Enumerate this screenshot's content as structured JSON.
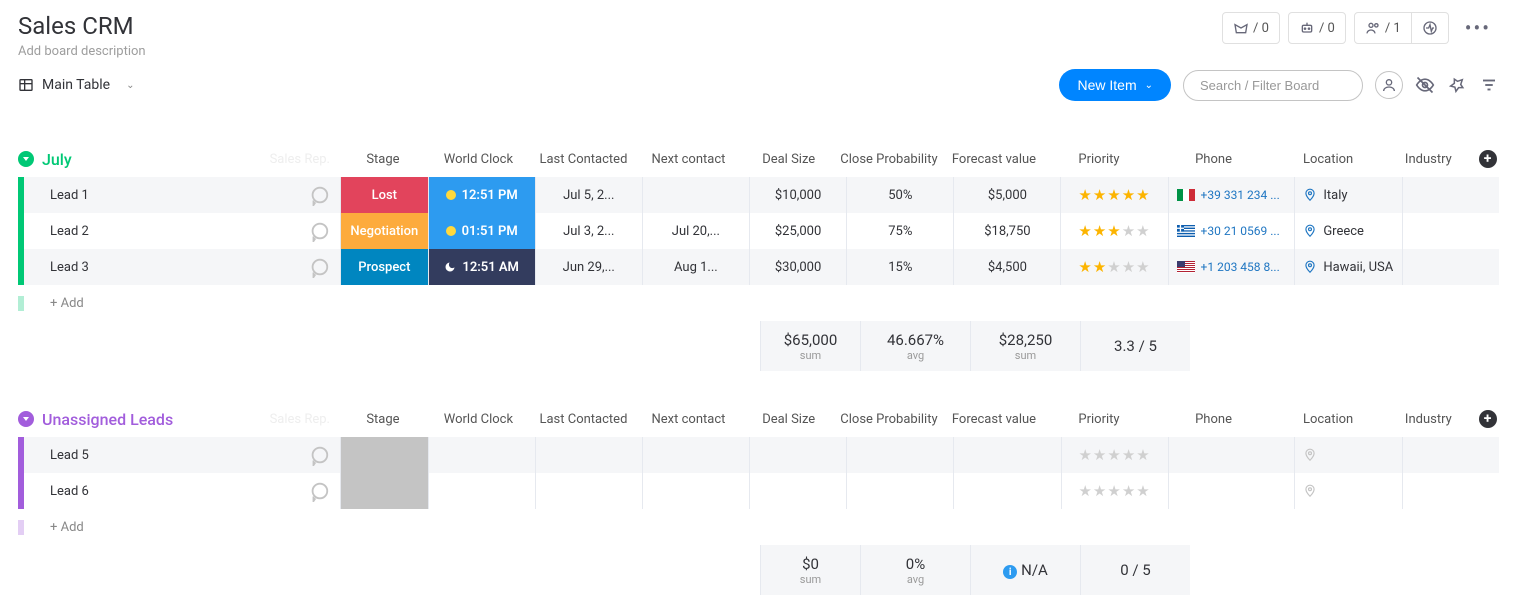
{
  "header": {
    "title": "Sales CRM",
    "description_placeholder": "Add board description",
    "mail_counter": "/ 0",
    "share_counter": "/ 0",
    "members_counter": "/ 1"
  },
  "toolbar": {
    "view_name": "Main Table",
    "new_item_label": "New Item",
    "search_placeholder": "Search / Filter Board"
  },
  "columns": {
    "sales_rep": "Sales Rep.",
    "stage": "Stage",
    "clock": "World Clock",
    "last_contacted": "Last Contacted",
    "next_contact": "Next contact",
    "deal_size": "Deal Size",
    "close_prob": "Close Probability",
    "forecast": "Forecast value",
    "priority": "Priority",
    "phone": "Phone",
    "location": "Location",
    "industry": "Industry"
  },
  "groups": [
    {
      "name": "July",
      "color": "#00c875",
      "rows": [
        {
          "name": "Lead 1",
          "stage": {
            "label": "Lost",
            "class": "stage-lost"
          },
          "clock": {
            "time": "12:51 PM",
            "daynight": "day",
            "class": "clock-blue"
          },
          "last_contacted": "Jul 5, 2...",
          "next_contact": "",
          "deal_size": "$10,000",
          "close_prob": "50%",
          "forecast": "$5,000",
          "priority": 5,
          "phone": {
            "flag": "it",
            "text": "+39 331 234 ..."
          },
          "location": "Italy"
        },
        {
          "name": "Lead 2",
          "stage": {
            "label": "Negotiation",
            "class": "stage-neg"
          },
          "clock": {
            "time": "01:51 PM",
            "daynight": "day",
            "class": "clock-blue"
          },
          "last_contacted": "Jul 3, 2...",
          "next_contact": "Jul 20,...",
          "deal_size": "$25,000",
          "close_prob": "75%",
          "forecast": "$18,750",
          "priority": 3,
          "phone": {
            "flag": "gr",
            "text": "+30 21 0569 ..."
          },
          "location": "Greece"
        },
        {
          "name": "Lead 3",
          "stage": {
            "label": "Prospect",
            "class": "stage-prospect"
          },
          "clock": {
            "time": "12:51 AM",
            "daynight": "night",
            "class": "clock-dark"
          },
          "last_contacted": "Jun 29,...",
          "next_contact": "Aug 1...",
          "deal_size": "$30,000",
          "close_prob": "15%",
          "forecast": "$4,500",
          "priority": 2,
          "phone": {
            "flag": "us",
            "text": "+1 203 458 8..."
          },
          "location": "Hawaii, USA"
        }
      ],
      "add_label": "+ Add",
      "summary": {
        "deal_size": {
          "value": "$65,000",
          "label": "sum"
        },
        "close_prob": {
          "value": "46.667%",
          "label": "avg"
        },
        "forecast": {
          "value": "$28,250",
          "label": "sum"
        },
        "priority": {
          "value": "3.3 / 5"
        }
      }
    },
    {
      "name": "Unassigned Leads",
      "color": "#a25ddc",
      "rows": [
        {
          "name": "Lead 5",
          "stage": {
            "label": "",
            "class": "stage-empty"
          },
          "priority": 0
        },
        {
          "name": "Lead 6",
          "stage": {
            "label": "",
            "class": "stage-empty"
          },
          "priority": 0
        }
      ],
      "add_label": "+ Add",
      "summary": {
        "deal_size": {
          "value": "$0",
          "label": "sum"
        },
        "close_prob": {
          "value": "0%",
          "label": "avg"
        },
        "forecast": {
          "value": "N/A",
          "info": true
        },
        "priority": {
          "value": "0 / 5"
        }
      }
    }
  ]
}
